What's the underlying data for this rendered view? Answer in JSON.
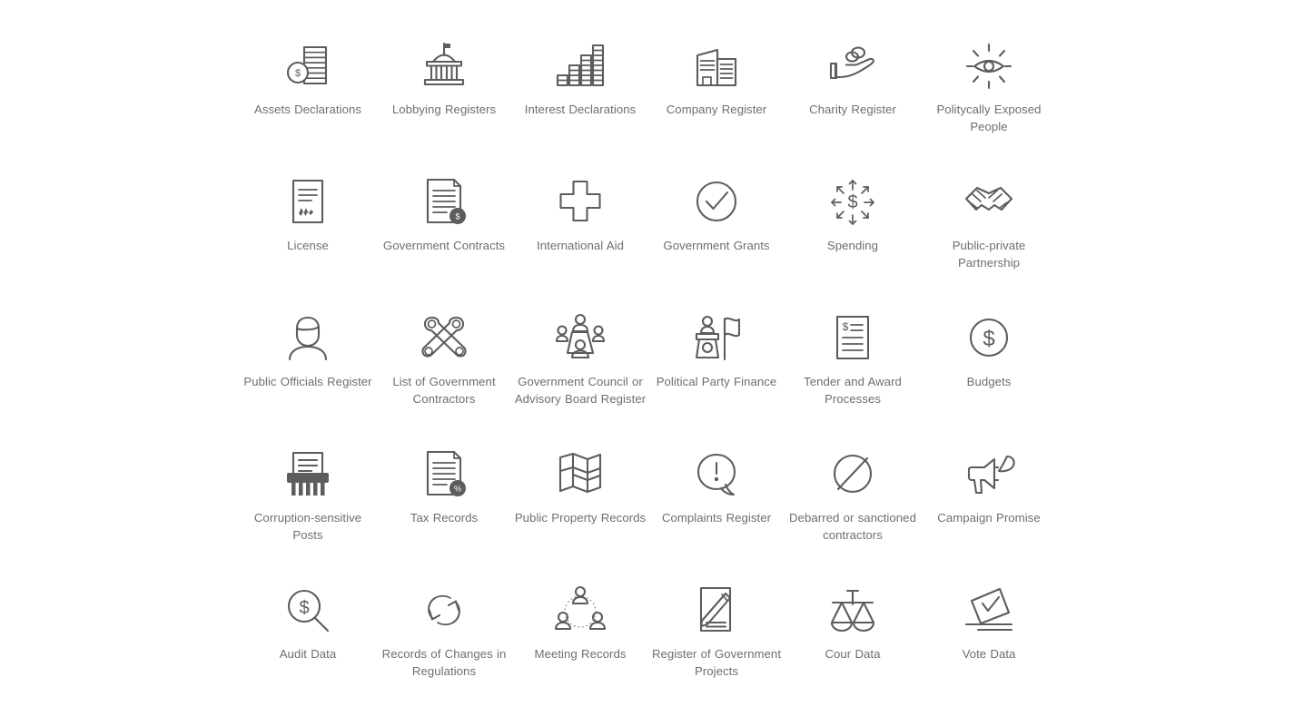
{
  "page": {
    "background_color": "#ffffff",
    "icon_stroke_color": "#5d5d5d",
    "label_text_color": "#6e6e6e",
    "columns": 6,
    "rows": 5,
    "total_items": 30
  },
  "items": [
    {
      "label": "Assets Declarations",
      "icon": "coin-and-stacked-bills-icon"
    },
    {
      "label": "Lobbying Registers",
      "icon": "classical-government-building-icon"
    },
    {
      "label": "Interest Declarations",
      "icon": "ascending-bar-stacks-icon"
    },
    {
      "label": "Company Register",
      "icon": "office-buildings-icon"
    },
    {
      "label": "Charity Register",
      "icon": "hand-with-coins-icon"
    },
    {
      "label": "Politycally Exposed People",
      "icon": "radiating-eye-icon"
    },
    {
      "label": "License",
      "icon": "signed-document-icon"
    },
    {
      "label": "Government Contracts",
      "icon": "document-with-dollar-badge-icon"
    },
    {
      "label": "International Aid",
      "icon": "medical-cross-icon"
    },
    {
      "label": "Government Grants",
      "icon": "check-in-circle-icon"
    },
    {
      "label": "Spending",
      "icon": "dollar-with-arrows-icon"
    },
    {
      "label": "Public-private Partnership",
      "icon": "handshake-icon"
    },
    {
      "label": "Public Officials Register",
      "icon": "person-bust-icon"
    },
    {
      "label": "List of Government Contractors",
      "icon": "crossed-wrenches-icon"
    },
    {
      "label": "Government Council or Advisory Board Register",
      "icon": "people-around-table-icon"
    },
    {
      "label": "Political Party Finance",
      "icon": "podium-speaker-with-flag-icon"
    },
    {
      "label": "Tender and Award Processes",
      "icon": "invoice-document-icon"
    },
    {
      "label": "Budgets",
      "icon": "dollar-in-circle-icon"
    },
    {
      "label": "Corruption-sensitive Posts",
      "icon": "paper-shredder-icon"
    },
    {
      "label": "Tax Records",
      "icon": "document-with-percent-badge-icon"
    },
    {
      "label": "Public Property Records",
      "icon": "folded-map-icon"
    },
    {
      "label": "Complaints Register",
      "icon": "exclamation-speech-bubble-icon"
    },
    {
      "label": "Debarred or sanctioned contractors",
      "icon": "prohibition-circle-icon"
    },
    {
      "label": "Campaign Promise",
      "icon": "megaphone-with-speech-bubble-icon"
    },
    {
      "label": "Audit Data",
      "icon": "magnifier-with-dollar-icon"
    },
    {
      "label": "Records of Changes in Regulations",
      "icon": "circular-refresh-arrows-icon"
    },
    {
      "label": "Meeting Records",
      "icon": "three-people-circle-icon"
    },
    {
      "label": "Register of Government Projects",
      "icon": "document-with-pen-icon"
    },
    {
      "label": "Cour Data",
      "icon": "scales-of-justice-icon"
    },
    {
      "label": "Vote Data",
      "icon": "ballot-box-checkmark-icon"
    }
  ]
}
